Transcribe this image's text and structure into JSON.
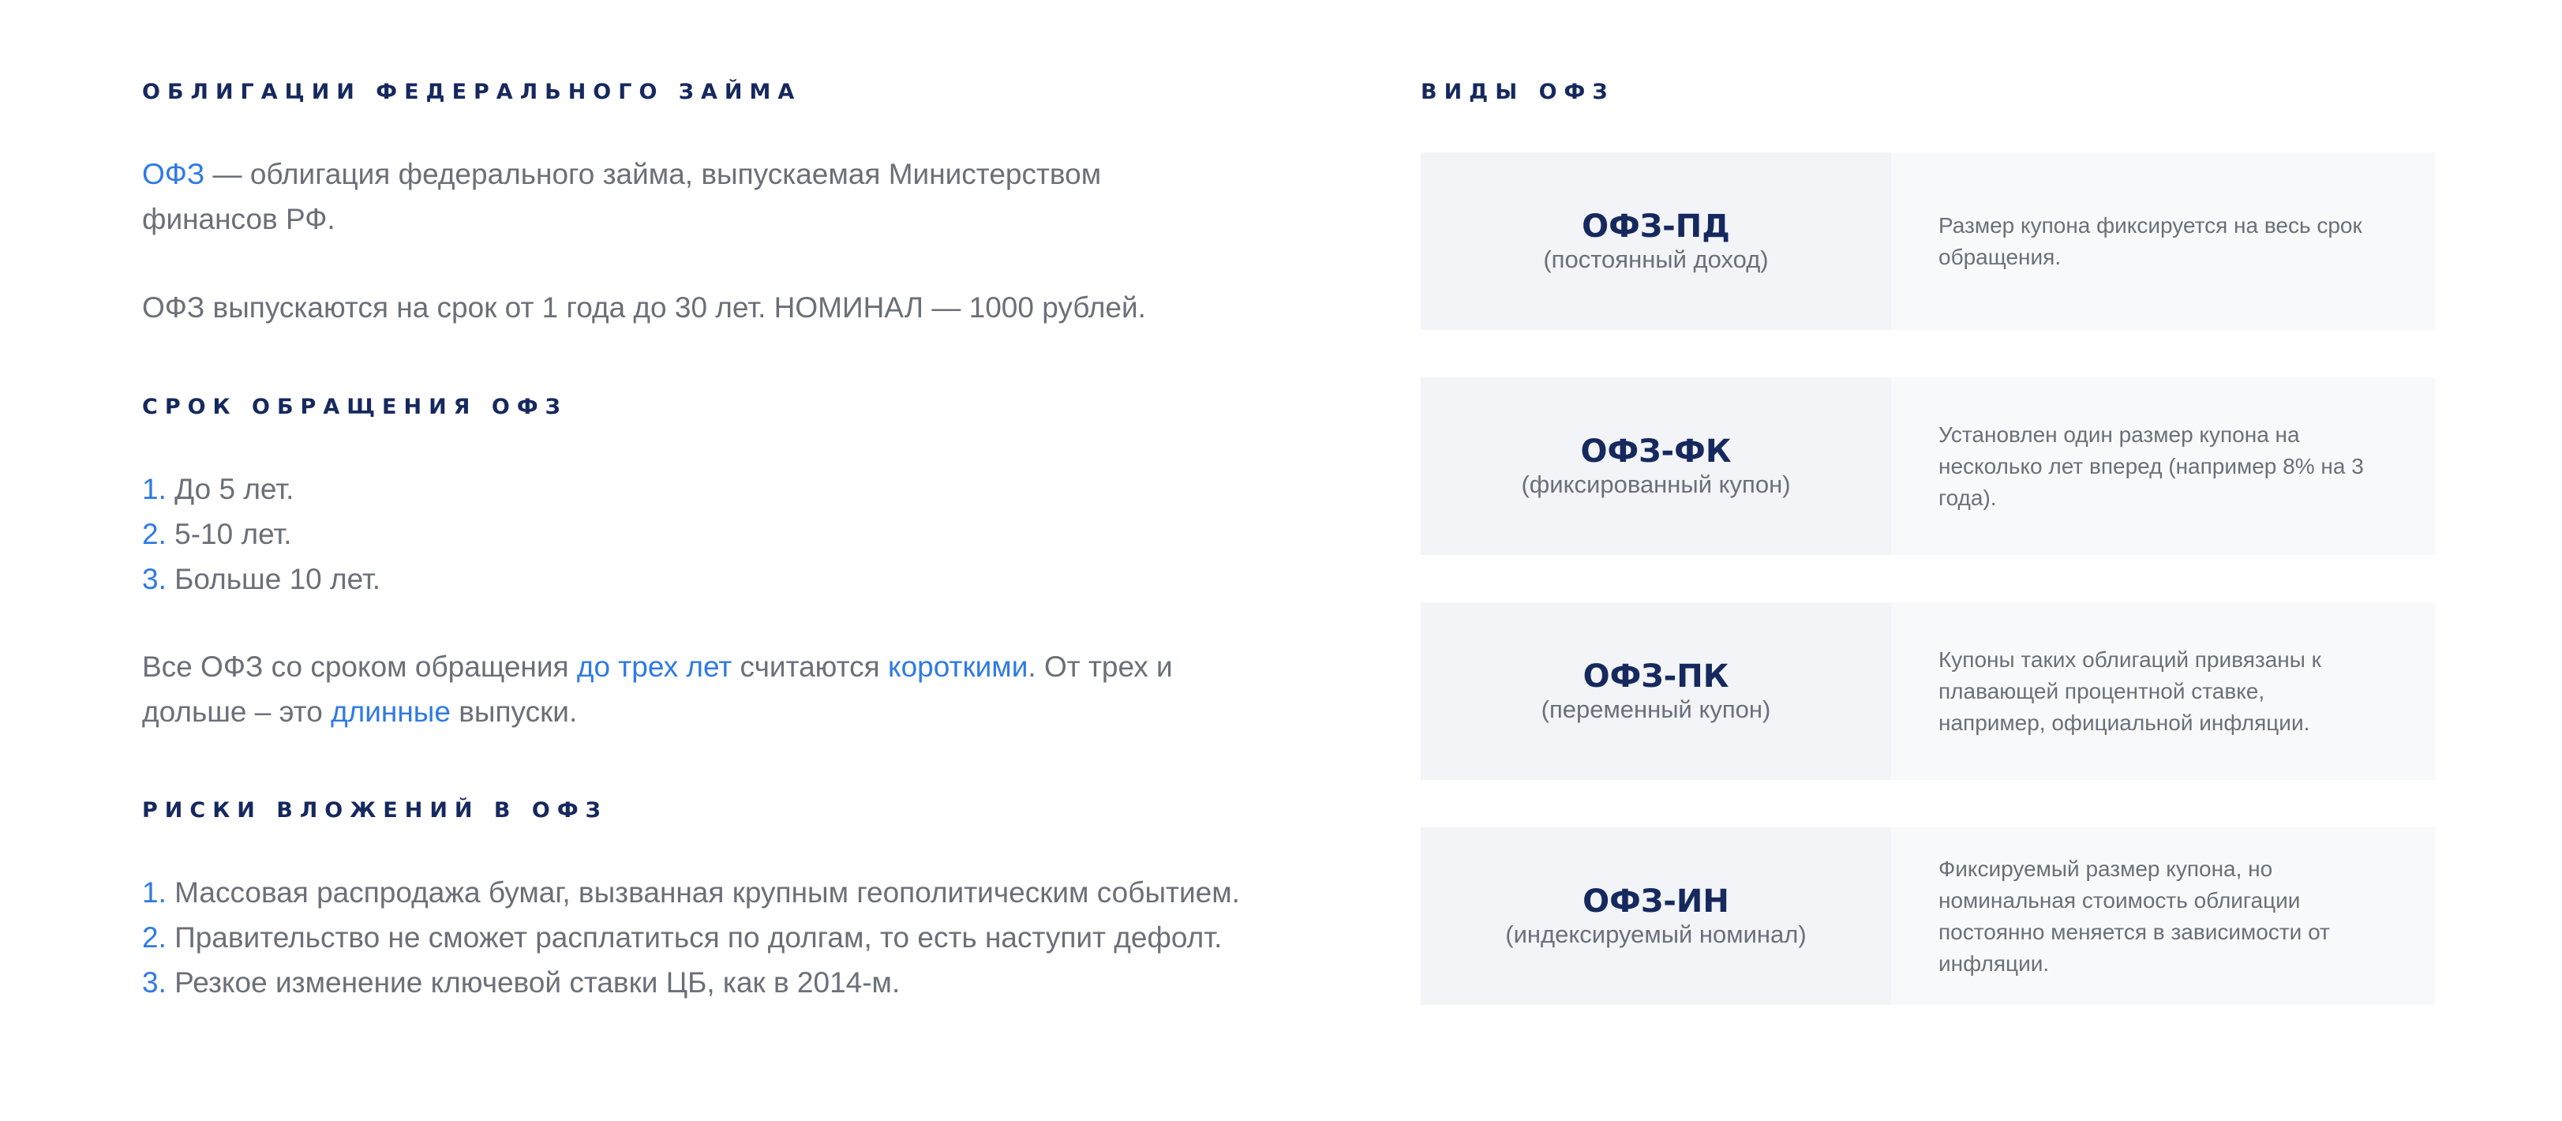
{
  "left": {
    "section1_title": "ОБЛИГАЦИИ ФЕДЕРАЛЬНОГО ЗАЙМА",
    "p1_term": "ОФЗ",
    "p1_rest": " — облигация федерального займа, выпускаемая Министерством финансов РФ.",
    "p2": "ОФЗ выпускаются на срок от 1 года до 30 лет. НОМИНАЛ — 1000 рублей.",
    "section2_title": "СРОК ОБРАЩЕНИЯ ОФЗ",
    "terms": [
      {
        "num": "1.",
        "text": " До 5 лет."
      },
      {
        "num": "2.",
        "text": " 5-10 лет."
      },
      {
        "num": "3.",
        "text": " Больше 10 лет."
      }
    ],
    "p3": {
      "a": "Все ОФЗ со сроком обращения ",
      "b": "до трех лет",
      "c": " считаются ",
      "d": "короткими",
      "e": ". От трех и дольше – это ",
      "f": "длинные",
      "g": " выпуски."
    },
    "section3_title": "РИСКИ ВЛОЖЕНИЙ В ОФЗ",
    "risks": [
      {
        "num": "1.",
        "text": " Массовая распродажа бумаг, вызванная крупным геополитическим событием."
      },
      {
        "num": "2.",
        "text": " Правительство не сможет расплатиться по долгам, то есть наступит дефолт."
      },
      {
        "num": "3.",
        "text": " Резкое изменение ключевой ставки ЦБ, как в 2014-м."
      }
    ]
  },
  "right": {
    "section_title": "ВИДЫ ОФЗ",
    "cards": [
      {
        "name": "ОФЗ-ПД",
        "sub": "(постоянный доход)",
        "desc": "Размер купона фиксируется на весь срок обращения."
      },
      {
        "name": "ОФЗ-ФК",
        "sub": "(фиксированный купон)",
        "desc": "Установлен один размер купона на несколько лет вперед (например 8% на 3 года)."
      },
      {
        "name": "ОФЗ-ПК",
        "sub": "(переменный купон)",
        "desc": "Купоны таких облигаций привязаны к плавающей процентной ставке, например, официальной инфляции."
      },
      {
        "name": "ОФЗ-ИН",
        "sub": "(индексируемый номинал)",
        "desc": "Фиксируемый размер купона, но номинальная стоимость облигации постоянно меняется в зависимости от инфляции."
      }
    ]
  },
  "colors": {
    "heading": "#16295e",
    "accent": "#2f7ae5",
    "body_text": "#6b6f78",
    "card_left_bg": "#f2f4f8",
    "card_right_bg": "#f8f9fb"
  }
}
